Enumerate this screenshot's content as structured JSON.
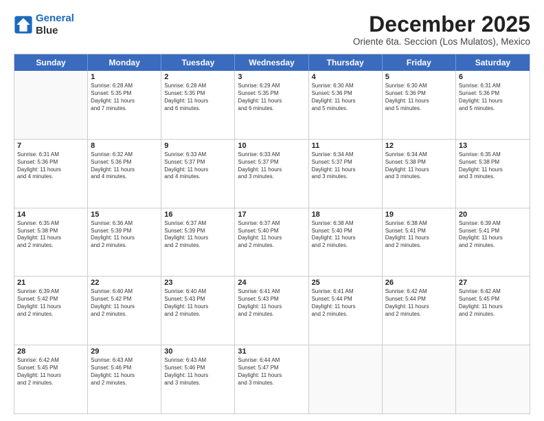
{
  "logo": {
    "line1": "General",
    "line2": "Blue"
  },
  "title": "December 2025",
  "subtitle": "Oriente 6ta. Seccion (Los Mulatos), Mexico",
  "header_days": [
    "Sunday",
    "Monday",
    "Tuesday",
    "Wednesday",
    "Thursday",
    "Friday",
    "Saturday"
  ],
  "weeks": [
    [
      {
        "day": "",
        "info": ""
      },
      {
        "day": "1",
        "info": "Sunrise: 6:28 AM\nSunset: 5:35 PM\nDaylight: 11 hours\nand 7 minutes."
      },
      {
        "day": "2",
        "info": "Sunrise: 6:28 AM\nSunset: 5:35 PM\nDaylight: 11 hours\nand 6 minutes."
      },
      {
        "day": "3",
        "info": "Sunrise: 6:29 AM\nSunset: 5:35 PM\nDaylight: 11 hours\nand 6 minutes."
      },
      {
        "day": "4",
        "info": "Sunrise: 6:30 AM\nSunset: 5:36 PM\nDaylight: 11 hours\nand 5 minutes."
      },
      {
        "day": "5",
        "info": "Sunrise: 6:30 AM\nSunset: 5:36 PM\nDaylight: 11 hours\nand 5 minutes."
      },
      {
        "day": "6",
        "info": "Sunrise: 6:31 AM\nSunset: 5:36 PM\nDaylight: 11 hours\nand 5 minutes."
      }
    ],
    [
      {
        "day": "7",
        "info": "Sunrise: 6:31 AM\nSunset: 5:36 PM\nDaylight: 11 hours\nand 4 minutes."
      },
      {
        "day": "8",
        "info": "Sunrise: 6:32 AM\nSunset: 5:36 PM\nDaylight: 11 hours\nand 4 minutes."
      },
      {
        "day": "9",
        "info": "Sunrise: 6:33 AM\nSunset: 5:37 PM\nDaylight: 11 hours\nand 4 minutes."
      },
      {
        "day": "10",
        "info": "Sunrise: 6:33 AM\nSunset: 5:37 PM\nDaylight: 11 hours\nand 3 minutes."
      },
      {
        "day": "11",
        "info": "Sunrise: 6:34 AM\nSunset: 5:37 PM\nDaylight: 11 hours\nand 3 minutes."
      },
      {
        "day": "12",
        "info": "Sunrise: 6:34 AM\nSunset: 5:38 PM\nDaylight: 11 hours\nand 3 minutes."
      },
      {
        "day": "13",
        "info": "Sunrise: 6:35 AM\nSunset: 5:38 PM\nDaylight: 11 hours\nand 3 minutes."
      }
    ],
    [
      {
        "day": "14",
        "info": "Sunrise: 6:35 AM\nSunset: 5:38 PM\nDaylight: 11 hours\nand 2 minutes."
      },
      {
        "day": "15",
        "info": "Sunrise: 6:36 AM\nSunset: 5:39 PM\nDaylight: 11 hours\nand 2 minutes."
      },
      {
        "day": "16",
        "info": "Sunrise: 6:37 AM\nSunset: 5:39 PM\nDaylight: 11 hours\nand 2 minutes."
      },
      {
        "day": "17",
        "info": "Sunrise: 6:37 AM\nSunset: 5:40 PM\nDaylight: 11 hours\nand 2 minutes."
      },
      {
        "day": "18",
        "info": "Sunrise: 6:38 AM\nSunset: 5:40 PM\nDaylight: 11 hours\nand 2 minutes."
      },
      {
        "day": "19",
        "info": "Sunrise: 6:38 AM\nSunset: 5:41 PM\nDaylight: 11 hours\nand 2 minutes."
      },
      {
        "day": "20",
        "info": "Sunrise: 6:39 AM\nSunset: 5:41 PM\nDaylight: 11 hours\nand 2 minutes."
      }
    ],
    [
      {
        "day": "21",
        "info": "Sunrise: 6:39 AM\nSunset: 5:42 PM\nDaylight: 11 hours\nand 2 minutes."
      },
      {
        "day": "22",
        "info": "Sunrise: 6:40 AM\nSunset: 5:42 PM\nDaylight: 11 hours\nand 2 minutes."
      },
      {
        "day": "23",
        "info": "Sunrise: 6:40 AM\nSunset: 5:43 PM\nDaylight: 11 hours\nand 2 minutes."
      },
      {
        "day": "24",
        "info": "Sunrise: 6:41 AM\nSunset: 5:43 PM\nDaylight: 11 hours\nand 2 minutes."
      },
      {
        "day": "25",
        "info": "Sunrise: 6:41 AM\nSunset: 5:44 PM\nDaylight: 11 hours\nand 2 minutes."
      },
      {
        "day": "26",
        "info": "Sunrise: 6:42 AM\nSunset: 5:44 PM\nDaylight: 11 hours\nand 2 minutes."
      },
      {
        "day": "27",
        "info": "Sunrise: 6:42 AM\nSunset: 5:45 PM\nDaylight: 11 hours\nand 2 minutes."
      }
    ],
    [
      {
        "day": "28",
        "info": "Sunrise: 6:42 AM\nSunset: 5:45 PM\nDaylight: 11 hours\nand 2 minutes."
      },
      {
        "day": "29",
        "info": "Sunrise: 6:43 AM\nSunset: 5:46 PM\nDaylight: 11 hours\nand 2 minutes."
      },
      {
        "day": "30",
        "info": "Sunrise: 6:43 AM\nSunset: 5:46 PM\nDaylight: 11 hours\nand 3 minutes."
      },
      {
        "day": "31",
        "info": "Sunrise: 6:44 AM\nSunset: 5:47 PM\nDaylight: 11 hours\nand 3 minutes."
      },
      {
        "day": "",
        "info": ""
      },
      {
        "day": "",
        "info": ""
      },
      {
        "day": "",
        "info": ""
      }
    ]
  ]
}
